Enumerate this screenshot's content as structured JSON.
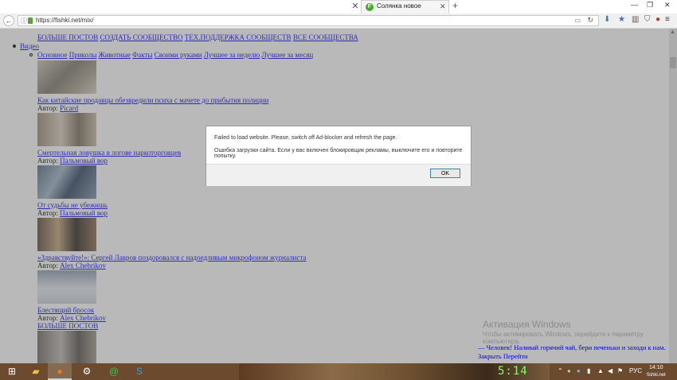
{
  "browser": {
    "tab_title": "Солянка новое",
    "url": "https://fishki.net/mix/",
    "tab_close": "✕",
    "new_tab": "+",
    "back": "←",
    "win_min": "—",
    "win_max": "❐",
    "win_close": "✕"
  },
  "page": {
    "top_nav": [
      "БОЛЬШЕ ПОСТОВ",
      "СОЗДАТЬ СООБЩЕСТВО",
      "ТЕХ.ПОДДЕРЖКА СООБЩЕСТВ",
      "ВСЕ СООБЩЕСТВА"
    ],
    "video_label": "Видео",
    "sub_nav": [
      "Основное",
      "Приколы",
      "Животные",
      "Факты",
      "Своими руками",
      "Лучшее за неделю",
      "Лучшее за месяц"
    ],
    "author_label": "Автор:",
    "posts": [
      {
        "title": "Как китайские продавцы обезвредили психа с мачете до прибытия полиции",
        "author": "Picard"
      },
      {
        "title": "Смертельная ловушка в логове наркоторговцев",
        "author": "Пальмовый вор"
      },
      {
        "title": "От судьбы не убежишь",
        "author": "Пальмовый вор"
      },
      {
        "title": "«Здравствуйте!»: Сергей Лавров поздоровался с надоедливым микрофоном журналиста",
        "author": "Alex Chebrikov"
      },
      {
        "title": "Блестящий бросок",
        "author": "Alex Chebrikov"
      }
    ],
    "more_posts": "БОЛЬШЕ ПОСТОВ",
    "ticker_text": "— Человек! Наливай горячий чай, бери печеньки и заходи к нам.",
    "ticker_close": "Закрыть",
    "ticker_go": "Перейти"
  },
  "watermark": {
    "title": "Активация Windows",
    "subtitle": "Чтобы активировать Windows, перейдите к параметру компьютера."
  },
  "dialog": {
    "message_en": "Failed to load website. Please, switch off Ad-blocker and refresh the page.",
    "message_ru": "Ошибка загрузки сайта. Если у вас включен блокировщик рекламы, выключите его и повторите попытку.",
    "ok_label": "OK"
  },
  "taskbar": {
    "lang": "РУС",
    "time": "14:10",
    "digital_clock": "5:14",
    "corner": "fishki.net"
  },
  "colors": {
    "link": "#0000ee",
    "overlay": "#646464",
    "taskbar": "#6b4a2d",
    "dialog_button_border": "#3c7fb1"
  }
}
